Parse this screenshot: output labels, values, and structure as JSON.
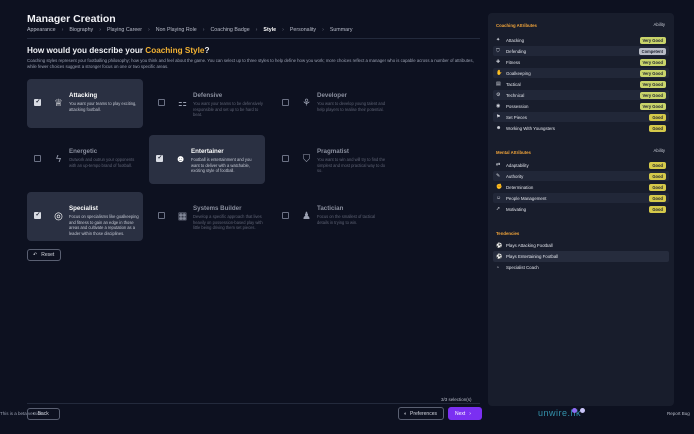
{
  "header": {
    "title": "Manager Creation",
    "breadcrumb": [
      "Appearance",
      "Biography",
      "Playing Career",
      "Non Playing Role",
      "Coaching Badge",
      "Style",
      "Personality",
      "Summary"
    ]
  },
  "question": {
    "prefix": "How would you describe your ",
    "highlight": "Coaching Style",
    "suffix": "?"
  },
  "description": "Coaching styles represent your footballing philosophy; how you think and feel about the game. You can select up to three styles to help define how you work; more choices reflect a manager who is capable across a number of attributes, while fewer choices suggest a stronger focus on one or two specific areas.",
  "styles": [
    {
      "name": "Attacking",
      "text": "You want your teams to play exciting, attacking football.",
      "selected": true,
      "icon": "trophy-icon"
    },
    {
      "name": "Defensive",
      "text": "You want your teams to be defensively responsible and set up to be hard to beat.",
      "selected": false,
      "icon": "tactics-board-icon"
    },
    {
      "name": "Developer",
      "text": "You want to develop young talent and help players to realise their potential.",
      "selected": false,
      "icon": "sprout-icon"
    },
    {
      "name": "Energetic",
      "text": "Outwork and outrun your opponents with an up-tempo brand of football.",
      "selected": false,
      "icon": "lightning-icon"
    },
    {
      "name": "Entertainer",
      "text": "Football is entertainment and you want to deliver with a watchable, exciting style of football.",
      "selected": true,
      "icon": "smile-icon"
    },
    {
      "name": "Pragmatist",
      "text": "You want to win and will try to find the simplest and most practical way to do so.",
      "selected": false,
      "icon": "shield-icon"
    },
    {
      "name": "Specialist",
      "text": "Focus on specialisms like goalkeeping and fitness to gain an edge in those areas and cultivate a reputation as a leader within those disciplines.",
      "selected": true,
      "icon": "target-icon"
    },
    {
      "name": "Systems Builder",
      "text": "Develop a specific approach that lives heavily on possession-based play with little being driving them set pieces.",
      "selected": false,
      "icon": "blocks-icon"
    },
    {
      "name": "Tactician",
      "text": "Focus on the smallest of tactical details in trying to win.",
      "selected": false,
      "icon": "pieces-icon"
    }
  ],
  "buttons": {
    "reset": "Reset",
    "back": "Back",
    "preferences": "Preferences",
    "next": "Next"
  },
  "selection_count": "3/3 selection(s)",
  "beta_text": "This is a beta version",
  "report_bug": "Report Bug",
  "watermark": "unwire.hk",
  "panel": {
    "coaching_header": "Coaching Attributes",
    "ability_label": "Ability",
    "coaching": [
      {
        "name": "Attacking",
        "badge": "Very Good",
        "level": "vg"
      },
      {
        "name": "Defending",
        "badge": "Competent",
        "level": "c"
      },
      {
        "name": "Fitness",
        "badge": "Very Good",
        "level": "vg"
      },
      {
        "name": "Goalkeeping",
        "badge": "Very Good",
        "level": "vg"
      },
      {
        "name": "Tactical",
        "badge": "Very Good",
        "level": "vg"
      },
      {
        "name": "Technical",
        "badge": "Very Good",
        "level": "vg"
      },
      {
        "name": "Possession",
        "badge": "Very Good",
        "level": "vg"
      },
      {
        "name": "Set Pieces",
        "badge": "Good",
        "level": "g"
      },
      {
        "name": "Working With Youngsters",
        "badge": "Good",
        "level": "g"
      }
    ],
    "mental_header": "Mental Attributes",
    "mental": [
      {
        "name": "Adaptability",
        "badge": "Good",
        "level": "g"
      },
      {
        "name": "Authority",
        "badge": "Good",
        "level": "g"
      },
      {
        "name": "Determination",
        "badge": "Good",
        "level": "g"
      },
      {
        "name": "People Management",
        "badge": "Good",
        "level": "g"
      },
      {
        "name": "Motivating",
        "badge": "Good",
        "level": "g"
      }
    ],
    "tendencies_header": "Tendencies",
    "tendencies": [
      "Plays Attacking Football",
      "Plays Entertaining Football",
      "Specialist Coach"
    ]
  },
  "colors": {
    "accent": "#7b2ff2",
    "highlight": "#f2b233",
    "background": "#0d1120",
    "panel": "#181d2c"
  }
}
